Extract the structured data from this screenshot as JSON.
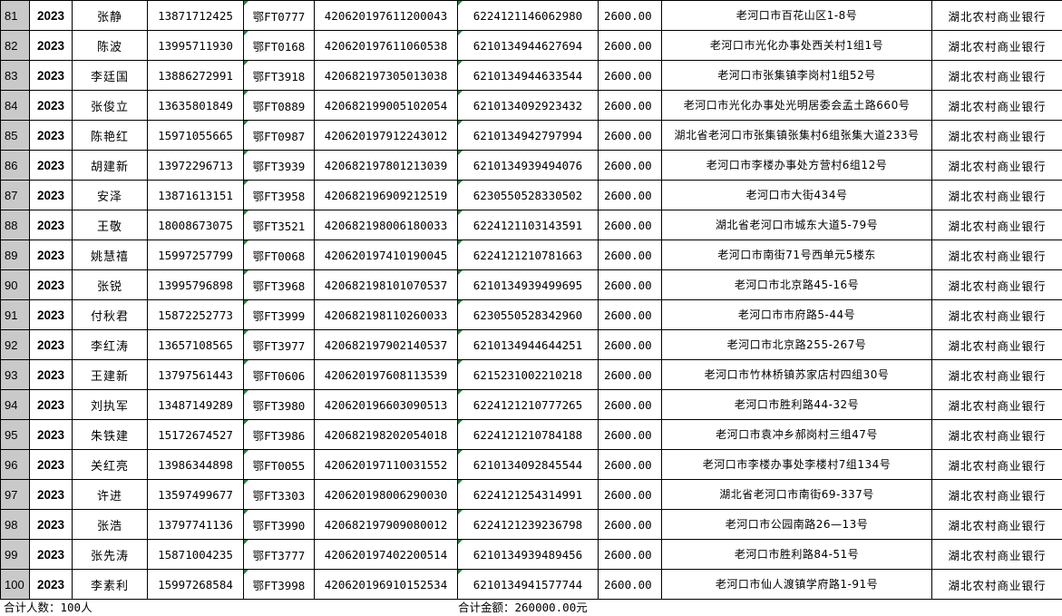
{
  "rows": [
    {
      "no": "81",
      "year": "2023",
      "name": "张静",
      "phone": "13871712425",
      "code": "鄂FT0777",
      "id": "420620197611200043",
      "card": "6224121146062980",
      "amount": "2600.00",
      "address": "老河口市百花山区1-8号",
      "bank": "湖北农村商业银行"
    },
    {
      "no": "82",
      "year": "2023",
      "name": "陈波",
      "phone": "13995711930",
      "code": "鄂FT0168",
      "id": "420620197611060538",
      "card": "6210134944627694",
      "amount": "2600.00",
      "address": "老河口市光化办事处西关村1组1号",
      "bank": "湖北农村商业银行"
    },
    {
      "no": "83",
      "year": "2023",
      "name": "李廷国",
      "phone": "13886272991",
      "code": "鄂FT3918",
      "id": "420682197305013038",
      "card": "6210134944633544",
      "amount": "2600.00",
      "address": "老河口市张集镇李岗村1组52号",
      "bank": "湖北农村商业银行"
    },
    {
      "no": "84",
      "year": "2023",
      "name": "张俊立",
      "phone": "13635801849",
      "code": "鄂FT0889",
      "id": "420682199005102054",
      "card": "6210134092923432",
      "amount": "2600.00",
      "address": "老河口市光化办事处光明居委会孟土路660号",
      "bank": "湖北农村商业银行"
    },
    {
      "no": "85",
      "year": "2023",
      "name": "陈艳红",
      "phone": "15971055665",
      "code": "鄂FT0987",
      "id": "420620197912243012",
      "card": "6210134942797994",
      "amount": "2600.00",
      "address": "湖北省老河口市张集镇张集村6组张集大道233号",
      "bank": "湖北农村商业银行"
    },
    {
      "no": "86",
      "year": "2023",
      "name": "胡建新",
      "phone": "13972296713",
      "code": "鄂FT3939",
      "id": "420682197801213039",
      "card": "6210134939494076",
      "amount": "2600.00",
      "address": "老河口市李楼办事处方营村6组12号",
      "bank": "湖北农村商业银行"
    },
    {
      "no": "87",
      "year": "2023",
      "name": "安泽",
      "phone": "13871613151",
      "code": "鄂FT3958",
      "id": "420682196909212519",
      "card": "6230550528330502",
      "amount": "2600.00",
      "address": "老河口市大街434号",
      "bank": "湖北农村商业银行"
    },
    {
      "no": "88",
      "year": "2023",
      "name": "王敬",
      "phone": "18008673075",
      "code": "鄂FT3521",
      "id": "420682198006180033",
      "card": "6224121103143591",
      "amount": "2600.00",
      "address": "湖北省老河口市城东大道5-79号",
      "bank": "湖北农村商业银行"
    },
    {
      "no": "89",
      "year": "2023",
      "name": "姚慧禧",
      "phone": "15997257799",
      "code": "鄂FT0068",
      "id": "420620197410190045",
      "card": "6224121210781663",
      "amount": "2600.00",
      "address": "老河口市南街71号西单元5楼东",
      "bank": "湖北农村商业银行"
    },
    {
      "no": "90",
      "year": "2023",
      "name": "张锐",
      "phone": "13995796898",
      "code": "鄂FT3968",
      "id": "420682198101070537",
      "card": "6210134939499695",
      "amount": "2600.00",
      "address": "老河口市北京路45-16号",
      "bank": "湖北农村商业银行"
    },
    {
      "no": "91",
      "year": "2023",
      "name": "付秋君",
      "phone": "15872252773",
      "code": "鄂FT3999",
      "id": "420682198110260033",
      "card": "6230550528342960",
      "amount": "2600.00",
      "address": "老河口市市府路5-44号",
      "bank": "湖北农村商业银行"
    },
    {
      "no": "92",
      "year": "2023",
      "name": "李红涛",
      "phone": "13657108565",
      "code": "鄂FT3977",
      "id": "420682197902140537",
      "card": "6210134944644251",
      "amount": "2600.00",
      "address": "老河口市北京路255-267号",
      "bank": "湖北农村商业银行"
    },
    {
      "no": "93",
      "year": "2023",
      "name": "王建新",
      "phone": "13797561443",
      "code": "鄂FT0606",
      "id": "420620197608113539",
      "card": "6215231002210218",
      "amount": "2600.00",
      "address": "老河口市竹林桥镇苏家店村四组30号",
      "bank": "湖北农村商业银行"
    },
    {
      "no": "94",
      "year": "2023",
      "name": "刘执军",
      "phone": "13487149289",
      "code": "鄂FT3980",
      "id": "420620196603090513",
      "card": "6224121210777265",
      "amount": "2600.00",
      "address": "老河口市胜利路44-32号",
      "bank": "湖北农村商业银行"
    },
    {
      "no": "95",
      "year": "2023",
      "name": "朱铁建",
      "phone": "15172674527",
      "code": "鄂FT3986",
      "id": "420682198202054018",
      "card": "6224121210784188",
      "amount": "2600.00",
      "address": "老河口市袁冲乡郝岗村三组47号",
      "bank": "湖北农村商业银行"
    },
    {
      "no": "96",
      "year": "2023",
      "name": "关红亮",
      "phone": "13986344898",
      "code": "鄂FT0055",
      "id": "420620197110031552",
      "card": "6210134092845544",
      "amount": "2600.00",
      "address": "老河口市李楼办事处李楼村7组134号",
      "bank": "湖北农村商业银行"
    },
    {
      "no": "97",
      "year": "2023",
      "name": "许进",
      "phone": "13597499677",
      "code": "鄂FT3303",
      "id": "420620198006290030",
      "card": "6224121254314991",
      "amount": "2600.00",
      "address": "湖北省老河口市南街69-337号",
      "bank": "湖北农村商业银行"
    },
    {
      "no": "98",
      "year": "2023",
      "name": "张浩",
      "phone": "13797741136",
      "code": "鄂FT3990",
      "id": "420682197909080012",
      "card": "6224121239236798",
      "amount": "2600.00",
      "address": "老河口市公园南路26—13号",
      "bank": "湖北农村商业银行"
    },
    {
      "no": "99",
      "year": "2023",
      "name": "张先涛",
      "phone": "15871004235",
      "code": "鄂FT3777",
      "id": "420620197402200514",
      "card": "6210134939489456",
      "amount": "2600.00",
      "address": "老河口市胜利路84-51号",
      "bank": "湖北农村商业银行"
    },
    {
      "no": "100",
      "year": "2023",
      "name": "李素利",
      "phone": "15997268584",
      "code": "鄂FT3998",
      "id": "420620196910152534",
      "card": "6210134941577744",
      "amount": "2600.00",
      "address": "老河口市仙人渡镇学府路1-91号",
      "bank": "湖北农村商业银行"
    }
  ],
  "footer": {
    "count": "合计人数：100人",
    "total": "合计金额：260000.00元"
  }
}
